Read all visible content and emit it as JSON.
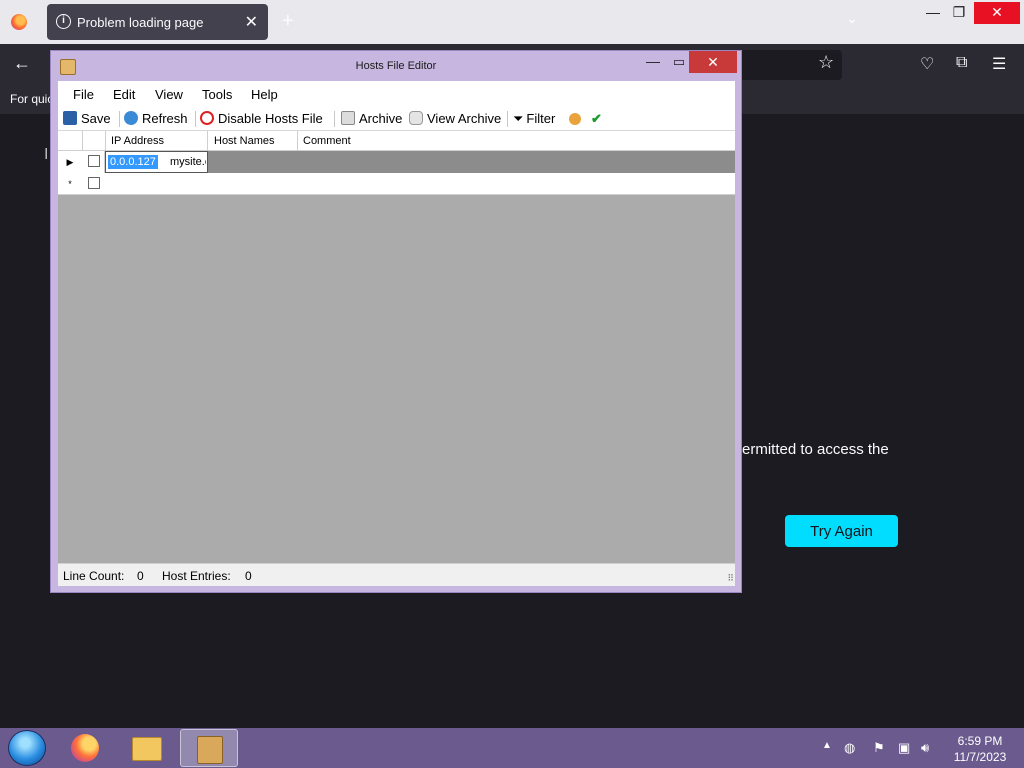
{
  "browser": {
    "tab_title": "Problem loading page",
    "tab_close": "✕",
    "new_tab": "+",
    "bookmarks_text": "For quic",
    "error_text": "ermitted to access the",
    "try_again_label": "Try Again"
  },
  "dialog": {
    "title": "Hosts File Editor",
    "menu": [
      "File",
      "Edit",
      "View",
      "Tools",
      "Help"
    ],
    "toolbar": {
      "save": "Save",
      "refresh": "Refresh",
      "disable": "Disable Hosts File",
      "archive": "Archive",
      "view_archive": "View Archive",
      "filter": "Filter"
    },
    "columns": [
      "IP Address",
      "Host Names",
      "Comment"
    ],
    "rows": [
      {
        "ip": "0.0.0.127",
        "host": "mysite.c",
        "comment": ""
      }
    ],
    "status": {
      "line_count_label": "Line Count:",
      "line_count": "0",
      "host_entries_label": "Host Entries:",
      "host_entries": "0"
    }
  },
  "taskbar": {
    "time": "6:59 PM",
    "date": "11/7/2023"
  },
  "colors": {
    "accent_button": "#00ddff",
    "dialog_frame": "#c7b6e0",
    "close_red": "#c8393a",
    "taskbar": "#6a5a8e"
  }
}
